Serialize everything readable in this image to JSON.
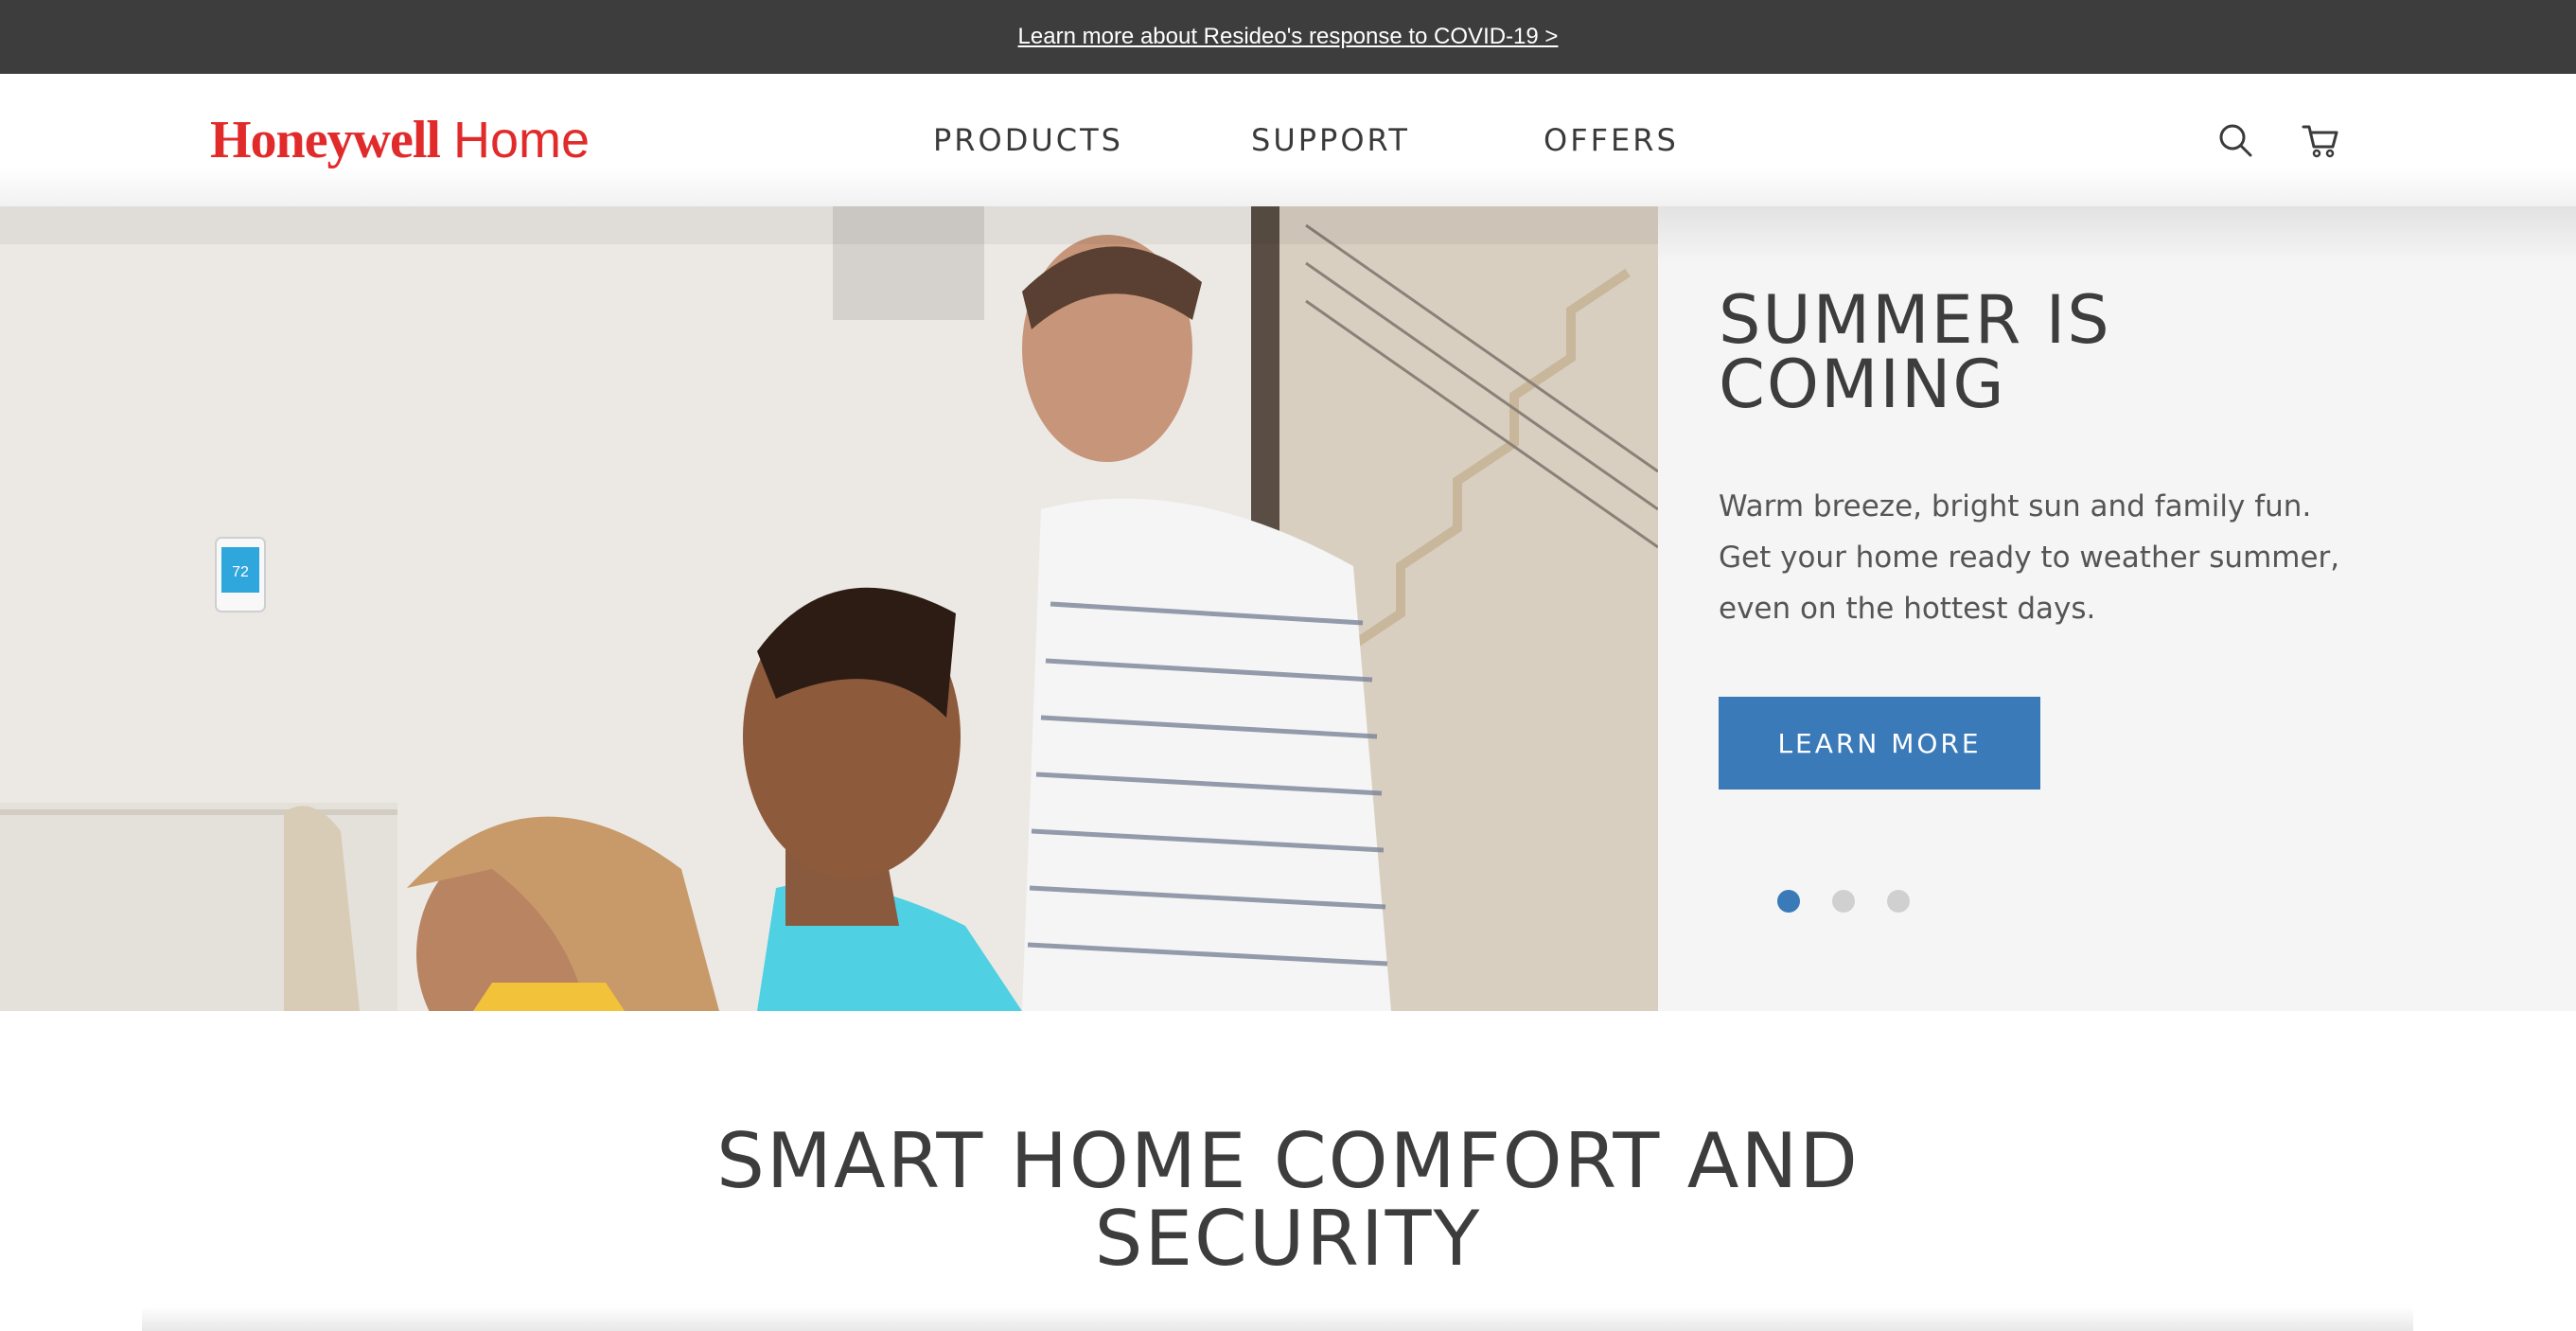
{
  "announcement": {
    "link_text": "Learn more about Resideo's response to COVID-19 >"
  },
  "header": {
    "logo": {
      "brand": "Honeywell",
      "sub": "Home"
    },
    "nav": [
      {
        "label": "PRODUCTS"
      },
      {
        "label": "SUPPORT"
      },
      {
        "label": "OFFERS"
      }
    ],
    "icons": {
      "search": "search-icon",
      "cart": "cart-icon"
    }
  },
  "hero": {
    "title": "SUMMER IS COMING",
    "text": "Warm breeze, bright sun and family fun. Get your home ready to weather summer, even on the hottest days.",
    "button_label": "LEARN MORE",
    "slides": {
      "count": 3,
      "active": 1
    },
    "thermostat_reading": "72"
  },
  "section": {
    "title": "SMART HOME COMFORT AND SECURITY"
  },
  "colors": {
    "brand_red": "#e12b2b",
    "accent_blue": "#3a7ab8",
    "topbar": "#3d3d3d",
    "text_dark": "#3d3d3d"
  }
}
